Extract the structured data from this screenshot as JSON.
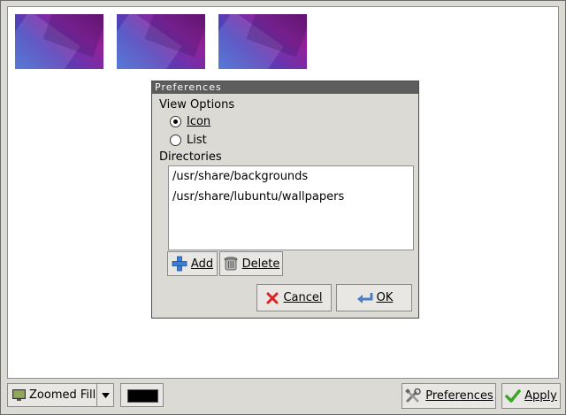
{
  "wallpapers": [
    {
      "name": "wallpaper-thumbnail-1"
    },
    {
      "name": "wallpaper-thumbnail-2"
    },
    {
      "name": "wallpaper-thumbnail-3"
    }
  ],
  "dialog": {
    "title": "Preferences",
    "view_options_label": "View Options",
    "radio_icon_label": "Icon",
    "radio_list_label": "List",
    "directories_label": "Directories",
    "directories": [
      "/usr/share/backgrounds",
      "/usr/share/lubuntu/wallpapers"
    ],
    "add_label": "Add",
    "delete_label": "Delete",
    "cancel_label": "Cancel",
    "ok_label": "OK"
  },
  "bottom_bar": {
    "mode_label": "Zoomed Fill",
    "color_value": "#000000",
    "preferences_label": "Preferences",
    "apply_label": "Apply"
  }
}
